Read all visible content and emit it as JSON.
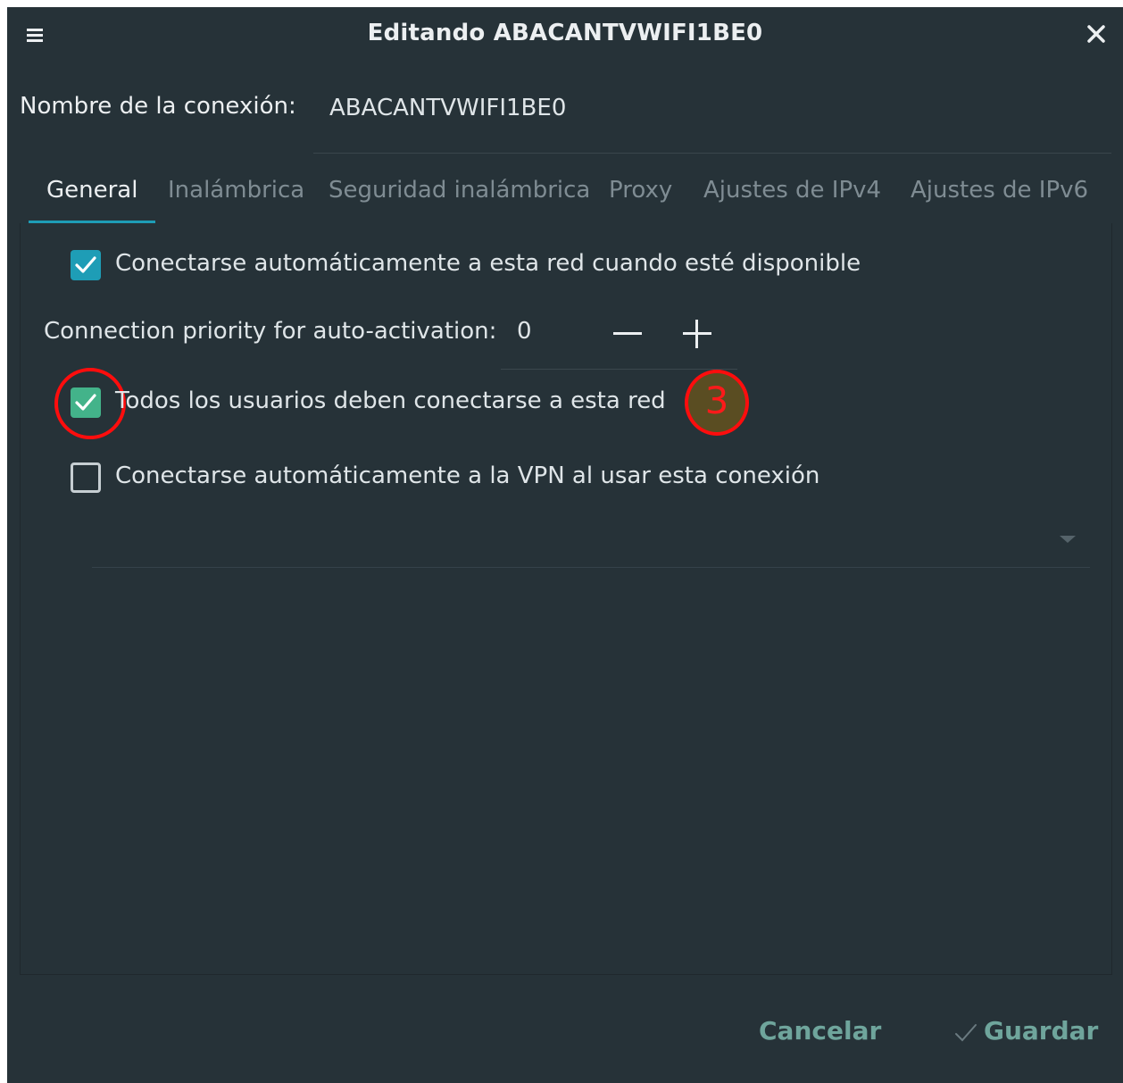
{
  "window": {
    "title": "Editando ABACANTVWIFI1BE0",
    "menu_icon": "hamburger-icon",
    "close_icon": "close-icon"
  },
  "connection_name": {
    "label": "Nombre de la conexión:",
    "value": "ABACANTVWIFI1BE0"
  },
  "tabs": [
    {
      "label": "General",
      "active": true
    },
    {
      "label": "Inalámbrica",
      "active": false
    },
    {
      "label": "Seguridad inalámbrica",
      "active": false
    },
    {
      "label": "Proxy",
      "active": false
    },
    {
      "label": "Ajustes de IPv4",
      "active": false
    },
    {
      "label": "Ajustes de IPv6",
      "active": false
    }
  ],
  "general": {
    "auto_connect": {
      "label": "Conectarse automáticamente a esta red cuando esté disponible",
      "checked": true
    },
    "priority": {
      "label": "Connection priority for auto-activation:",
      "value": "0"
    },
    "all_users": {
      "label": "Todos los usuarios deben conectarse a esta red",
      "checked": true
    },
    "vpn_auto": {
      "label": "Conectarse automáticamente a la VPN al usar esta conexión",
      "checked": false
    },
    "vpn_select": {
      "value": ""
    }
  },
  "annotation": {
    "badge_text": "3"
  },
  "footer": {
    "cancel_label": "Cancelar",
    "save_label": "Guardar"
  },
  "colors": {
    "background": "#263238",
    "accent": "#1e9db6",
    "annotation_red": "#ff0d0d",
    "button_text": "#6fa59c"
  }
}
